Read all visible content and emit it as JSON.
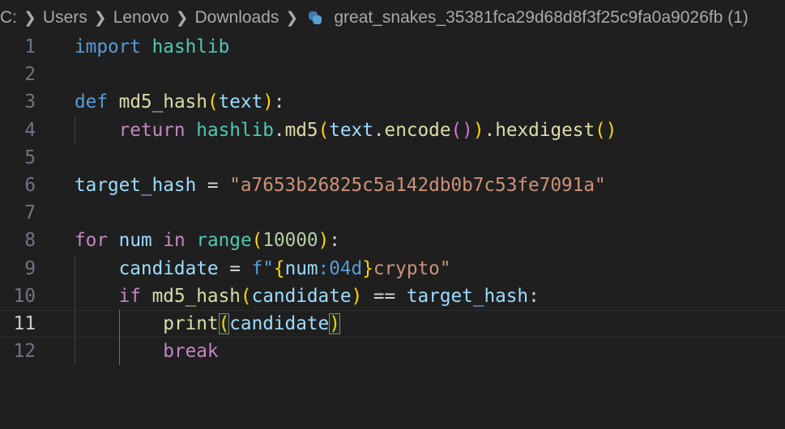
{
  "breadcrumb": {
    "items": [
      "C:",
      "Users",
      "Lenovo",
      "Downloads"
    ],
    "file_icon": "python-icon",
    "file_name": "great_snakes_35381fca29d68d8f3f25c9fa0a9026fb (1)"
  },
  "editor": {
    "active_line": 11,
    "lines": [
      {
        "n": "1",
        "indent": 0,
        "tokens": [
          [
            "import",
            "kw"
          ],
          [
            " ",
            "op"
          ],
          [
            "hashlib",
            "cls"
          ]
        ]
      },
      {
        "n": "2",
        "indent": 0,
        "tokens": []
      },
      {
        "n": "3",
        "indent": 0,
        "tokens": [
          [
            "def",
            "kw"
          ],
          [
            " ",
            "op"
          ],
          [
            "md5_hash",
            "fn"
          ],
          [
            "(",
            "b1"
          ],
          [
            "text",
            "var"
          ],
          [
            ")",
            "b1"
          ],
          [
            ":",
            "op"
          ]
        ]
      },
      {
        "n": "4",
        "indent": 1,
        "tokens": [
          [
            "    ",
            "op"
          ],
          [
            "return",
            "ctl"
          ],
          [
            " ",
            "op"
          ],
          [
            "hashlib",
            "cls"
          ],
          [
            ".",
            "op"
          ],
          [
            "md5",
            "fn"
          ],
          [
            "(",
            "b1"
          ],
          [
            "text",
            "var"
          ],
          [
            ".",
            "op"
          ],
          [
            "encode",
            "fn"
          ],
          [
            "()",
            "b2"
          ],
          [
            ")",
            "b1"
          ],
          [
            ".",
            "op"
          ],
          [
            "hexdigest",
            "fn"
          ],
          [
            "()",
            "b1"
          ]
        ]
      },
      {
        "n": "5",
        "indent": 0,
        "tokens": []
      },
      {
        "n": "6",
        "indent": 0,
        "tokens": [
          [
            "target_hash",
            "var"
          ],
          [
            " = ",
            "op"
          ],
          [
            "\"a7653b26825c5a142db0b7c53fe7091a\"",
            "str"
          ]
        ]
      },
      {
        "n": "7",
        "indent": 0,
        "tokens": []
      },
      {
        "n": "8",
        "indent": 0,
        "tokens": [
          [
            "for",
            "ctl"
          ],
          [
            " ",
            "op"
          ],
          [
            "num",
            "var"
          ],
          [
            " ",
            "op"
          ],
          [
            "in",
            "ctl"
          ],
          [
            " ",
            "op"
          ],
          [
            "range",
            "cls"
          ],
          [
            "(",
            "b1"
          ],
          [
            "10000",
            "num"
          ],
          [
            ")",
            "b1"
          ],
          [
            ":",
            "op"
          ]
        ]
      },
      {
        "n": "9",
        "indent": 1,
        "tokens": [
          [
            "    ",
            "op"
          ],
          [
            "candidate",
            "var"
          ],
          [
            " = ",
            "op"
          ],
          [
            "f\"",
            "kw"
          ],
          [
            "{",
            "b1"
          ],
          [
            "num",
            "var"
          ],
          [
            ":04d",
            "kw"
          ],
          [
            "}",
            "b1"
          ],
          [
            "crypto\"",
            "str"
          ]
        ]
      },
      {
        "n": "10",
        "indent": 1,
        "tokens": [
          [
            "    ",
            "op"
          ],
          [
            "if",
            "ctl"
          ],
          [
            " ",
            "op"
          ],
          [
            "md5_hash",
            "fn"
          ],
          [
            "(",
            "b1"
          ],
          [
            "candidate",
            "var"
          ],
          [
            ")",
            "b1"
          ],
          [
            " == ",
            "op"
          ],
          [
            "target_hash",
            "var"
          ],
          [
            ":",
            "op"
          ]
        ]
      },
      {
        "n": "11",
        "indent": 2,
        "tokens": [
          [
            "        ",
            "op"
          ],
          [
            "print",
            "fn"
          ],
          [
            "(",
            "bm"
          ],
          [
            "candidate",
            "var"
          ],
          [
            ")",
            "bm"
          ]
        ]
      },
      {
        "n": "12",
        "indent": 2,
        "tokens": [
          [
            "        ",
            "op"
          ],
          [
            "break",
            "ctl"
          ]
        ]
      }
    ]
  }
}
